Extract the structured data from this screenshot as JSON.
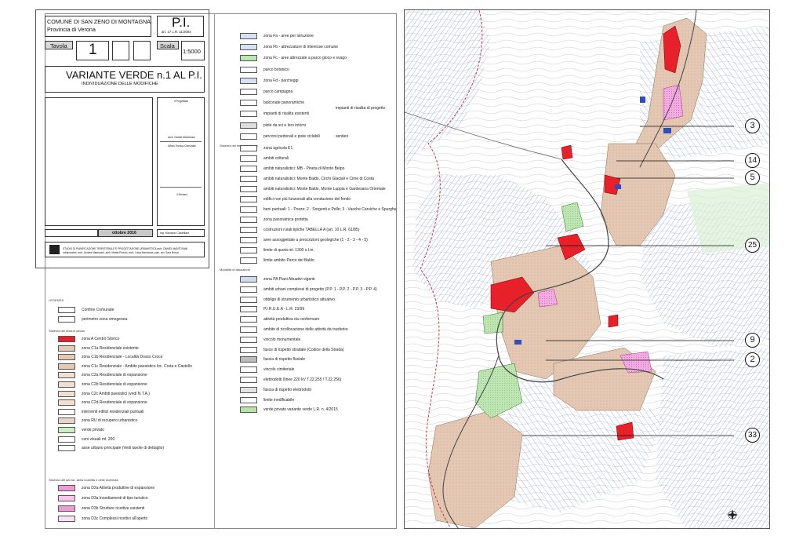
{
  "title_block": {
    "municipality": "COMUNE DI SAN ZENO DI MONTAGNA",
    "province": "Provincia di Verona",
    "plan_code": "P.I.",
    "law_ref": "art. 17 L.R. 11/2004",
    "sheet_label": "Tavola",
    "sheet_number": "1",
    "scale_label": "Scala",
    "scale_value": "1:5000",
    "main_title": "VARIANTE VERDE n.1 AL P.I.",
    "subtitle": "INDIVIDUAZIONE DELLE MODIFICHE",
    "sig_progettista": "Il Progettista",
    "sig_arch": "arch. Daniel Mantovani",
    "sig_ufficio": "Ufficio Tecnico Comunale",
    "sig_sindaco": "Il Sindaco",
    "sig_ing": "ing. Maurizio Castellani",
    "date": "ottobre 2016",
    "studio_line1": "STUDIO DI PIANIFICAZIONE TERRITORIALE E PROGETTAZIONE URBANISTICA arch. DANIEL MANTOVANI",
    "studio_line2": "collaboratori: arch. Andrea Mantovani, arch. Mattia Pizzolo, arch. Luisa Mantovani, pian. terr. Sara Bruzzi"
  },
  "legend_left": {
    "heading": "LEGENDA",
    "items_top": [
      {
        "label": "Confine Comunale",
        "color": "#ffffff"
      },
      {
        "label": "perimetro zona omogenea",
        "color": "#ffffff"
      }
    ],
    "section_urban": "Sistema dei tessuti urbani",
    "items_urban": [
      {
        "label": "zona A Centro Storico",
        "color": "#e8202a"
      },
      {
        "label": "zona C1a Residenziale esistente",
        "color": "#e6c9b4"
      },
      {
        "label": "zona C1b Residenziale - Località Dosso Croce",
        "color": "#e6c9b4"
      },
      {
        "label": "zona C1c Residenziale - Ambito paesistico loc. Creta e Castello",
        "color": "#e6c9b4"
      },
      {
        "label": "zona C2a Residenziale di espansione",
        "color": "#f1dfd2"
      },
      {
        "label": "zona C2b Residenziale di espansione",
        "color": "#f1dfd2"
      },
      {
        "label": "zona C2c Ambiti paesistici (vedi N.T.A.)",
        "color": "#f1dfd2"
      },
      {
        "label": "zona C2d Residenziale di espansione",
        "color": "#f1dfd2"
      },
      {
        "label": "interventi edilizi residenziali puntuali",
        "color": "#ffffff"
      },
      {
        "label": "zona RU di recupero urbanistico",
        "color": "#e9d7c6"
      },
      {
        "label": "verde privato",
        "color": "#c9efc2"
      },
      {
        "label": "coni visuali ml. 200",
        "color": "#ffffff"
      },
      {
        "label": "asse urbano principale (Vedi tavole di dettaglio)",
        "color": "#ffffff"
      }
    ],
    "section_services": "Sistema dei servizi, della mobilità e delle ricettività",
    "items_services": [
      {
        "label": "zona D2a Attività produttive di espansione",
        "color": "#f29ad6"
      },
      {
        "label": "zona D3a Insediamenti di tipo turistico",
        "color": "#f7c6ea"
      },
      {
        "label": "zona D3b Strutture ricettive esistenti",
        "color": "#f29ad6"
      },
      {
        "label": "zona D3c Complessi ricettivi all'aperto",
        "color": "#fbe0f3"
      }
    ]
  },
  "legend_right": {
    "items_services": [
      {
        "label": "zona Fa - aree per istruzione",
        "color": "#d6e2f3"
      },
      {
        "label": "zona Fb - attrezzature di interesse comune",
        "color": "#d6e2f3"
      },
      {
        "label": "zona Fc - aree attrezzate a parco gioco e svago",
        "color": "#b8e8b0"
      },
      {
        "label": "parco botanico",
        "color": "#ffffff"
      },
      {
        "label": "zona Fd - parcheggi",
        "color": "#d6e2f3"
      },
      {
        "label": "parco campagna",
        "color": "#ffffff"
      },
      {
        "label": "balconate panoramiche",
        "color": "#ffffff"
      },
      {
        "label": "impianti di risalita esistenti",
        "color": "#ffffff"
      },
      {
        "label": "piste da sci e loro intorni",
        "color": "#dddddd"
      },
      {
        "label": "percorsi pedonali e piste ciclabili",
        "color": "#ffffff"
      }
    ],
    "impianti_progetto": "impianti di risalita di progetto",
    "sentieri": "sentieri",
    "section_open": "Sistema del territorio aperto",
    "items_open": [
      {
        "label": "zona agricola E1",
        "color": "#ffffff"
      },
      {
        "label": "ambiti colturali",
        "color": "#ffffff"
      },
      {
        "label": "ambiti naturalistici: MB - Pineta di Monte Belpo",
        "color": "#ffffff"
      },
      {
        "label": "ambiti naturalistici: Monte Baldo, Circhi Glaciali e Cime di Costa",
        "color": "#ffffff"
      },
      {
        "label": "ambiti naturalistici: Monte Baldo, Monte Luppia e Gardesana Orientale",
        "color": "#ffffff"
      },
      {
        "label": "edifici non più funzionali alla conduzione del fondo",
        "color": "#ffffff"
      },
      {
        "label": "beni puntuali: 1 - Pozze; 2 - Sorgenti e Polle; 3 - Vasche Carsiche e Spurghe",
        "color": "#ffffff"
      },
      {
        "label": "zona panoramica protetta",
        "color": "#ffffff"
      },
      {
        "label": "costruzioni rurali tipiche TABELLA A (art. 10 L.R. 61/85)",
        "color": "#ffffff"
      },
      {
        "label": "aree assoggettate a prescrizioni geologiche (1 - 2 - 3 - 4 - 5)",
        "color": "#ffffff"
      },
      {
        "label": "limite di quota ml. 1300 s.l.m.",
        "color": "#ffffff"
      },
      {
        "label": "limite ambito Parco del Baldo",
        "color": "#ffffff"
      }
    ],
    "section_modes": "Modalità di attuazione",
    "items_modes": [
      {
        "label": "zona PA Piani Attuativi vigenti",
        "color": "#cfdcf0"
      },
      {
        "label": "ambiti urbani complessi di progetto (P.P. 1 - P.P. 2 - P.P. 3 - P.P. 4)",
        "color": "#ffffff"
      },
      {
        "label": "obbligo di strumento urbanistico attuativo",
        "color": "#ffffff"
      },
      {
        "label": "P.I.R.U.E.A - L.R. 23/99",
        "color": "#ffffff"
      },
      {
        "label": "attività produttiva da confermare",
        "color": "#ffffff"
      },
      {
        "label": "ambito di ricollocazione delle attività da trasferire",
        "color": "#ffffff"
      },
      {
        "label": "vincolo monumentale",
        "color": "#ffffff"
      },
      {
        "label": "fasce di rispetto stradale (Codice della Strada)",
        "color": "#ffffff"
      },
      {
        "label": "fascia di rispetto fluviale",
        "color": "#bdbdbd"
      },
      {
        "label": "vincolo cimiteriale",
        "color": "#ffffff"
      },
      {
        "label": "elettrodotti (linee 220 kV T.22.255 / T.22.256)",
        "color": "#ffffff"
      },
      {
        "label": "fascia di rispetto elettrodotti",
        "color": "#e3e3e3"
      },
      {
        "label": "limite inedificabile",
        "color": "#ffffff"
      },
      {
        "label": "verde privato variante verde L.R. n. 4/2015",
        "color": "#b6e6a6"
      }
    ]
  },
  "map": {
    "callouts": [
      "3",
      "14",
      "5",
      "25",
      "9",
      "2",
      "33"
    ],
    "colors": {
      "blue_hatch": "#5b7fd6",
      "red_zone": "#e8202a",
      "pink_zone": "#e48ad0",
      "tan_zone": "#d9b9a1",
      "green_zone": "#9ad48f"
    }
  }
}
